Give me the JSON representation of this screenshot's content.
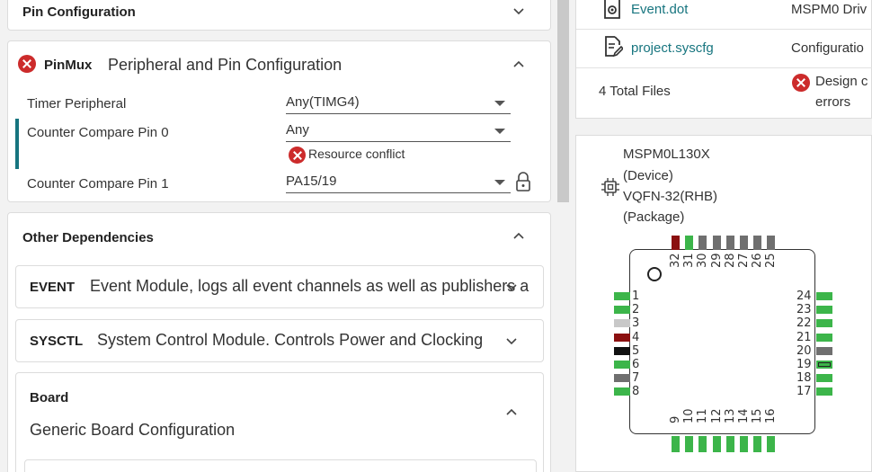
{
  "pin_configuration": {
    "title": "Pin Configuration"
  },
  "pinmux": {
    "key": "PinMux",
    "title": "Peripheral and Pin Configuration",
    "fields": [
      {
        "label": "Timer Peripheral",
        "value": "Any(TIMG4)"
      },
      {
        "label": "Counter Compare Pin 0",
        "value": "Any",
        "error": "Resource conflict"
      },
      {
        "label": "Counter Compare Pin 1",
        "value": "PA15/19"
      }
    ]
  },
  "dependencies": {
    "title": "Other Dependencies",
    "items": [
      {
        "key": "EVENT",
        "desc": "Event Module, logs all event channels as well as publishers a"
      },
      {
        "key": "SYSCTL",
        "desc": "System Control Module. Controls Power and Clocking"
      }
    ],
    "board": {
      "key": "Board",
      "desc": "Generic Board Configuration"
    }
  },
  "files": {
    "rows": [
      {
        "name": "Event.dot",
        "type": "MSPM0 Driv"
      },
      {
        "name": "project.syscfg",
        "type": "Configuratio"
      }
    ],
    "total": "4 Total Files",
    "status_line1": "Design c",
    "status_line2": "errors"
  },
  "device": {
    "name": "MSPM0L130X",
    "name_note": "(Device)",
    "package": "VQFN-32(RHB)",
    "package_note": "(Package)"
  },
  "pins": {
    "left": [
      "1",
      "2",
      "3",
      "4",
      "5",
      "6",
      "7",
      "8"
    ],
    "right": [
      "24",
      "23",
      "22",
      "21",
      "20",
      "19",
      "18",
      "17"
    ],
    "top": [
      "32",
      "31",
      "30",
      "29",
      "28",
      "27",
      "26",
      "25"
    ],
    "bottom": [
      "9",
      "10",
      "11",
      "12",
      "13",
      "14",
      "15",
      "16"
    ]
  },
  "colors": {
    "accent": "#17757f",
    "error": "#cc2b2b",
    "pin_green": "#3cb54a",
    "pin_grey": "#6f6f6f",
    "pin_lightgrey": "#c8c8c8",
    "pin_red": "#8b1010",
    "pin_black": "#111111"
  }
}
